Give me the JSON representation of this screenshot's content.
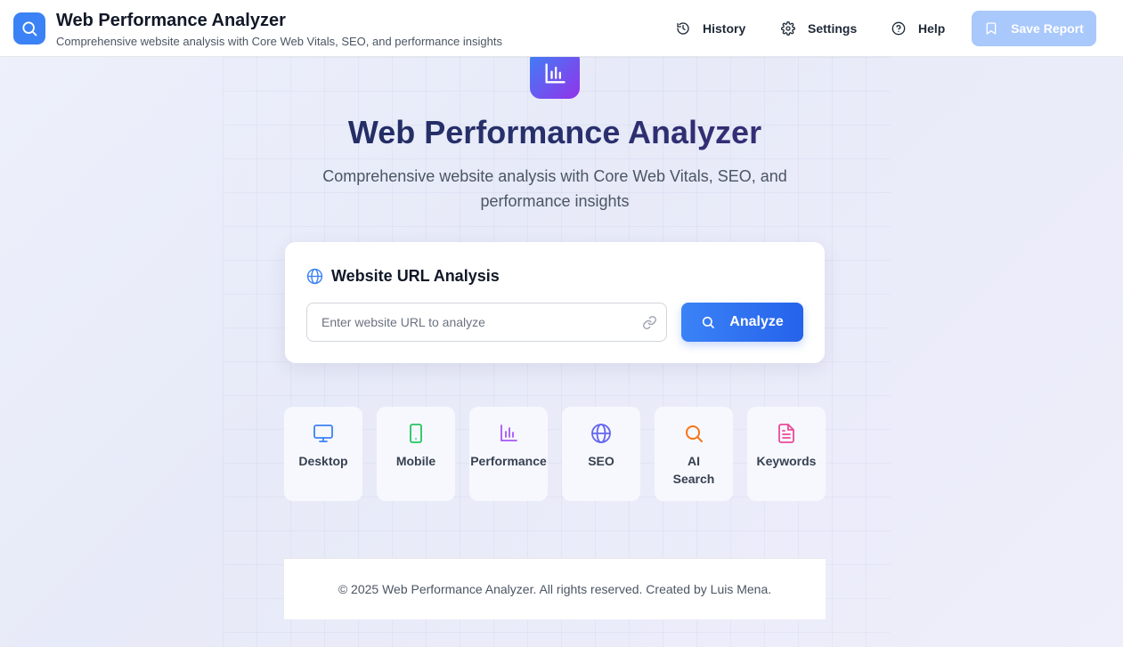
{
  "header": {
    "title": "Web Performance Analyzer",
    "subtitle": "Comprehensive website analysis with Core Web Vitals, SEO, and performance insights",
    "nav": [
      {
        "label": "History",
        "icon": "history-icon"
      },
      {
        "label": "Settings",
        "icon": "gear-icon"
      },
      {
        "label": "Help",
        "icon": "help-icon"
      }
    ],
    "save_label": "Save Report"
  },
  "hero": {
    "title": "Web Performance Analyzer",
    "subtitle": "Comprehensive website analysis with Core Web Vitals, SEO, and performance insights"
  },
  "url_card": {
    "heading": "Website URL Analysis",
    "input_placeholder": "Enter website URL to analyze",
    "input_value": "",
    "analyze_label": "Analyze"
  },
  "features": [
    {
      "label": "Desktop",
      "icon": "monitor-icon",
      "color": "#3b82f6"
    },
    {
      "label": "Mobile",
      "icon": "smartphone-icon",
      "color": "#22c55e"
    },
    {
      "label": "Performance",
      "icon": "bar-chart-icon",
      "color": "#a855f7"
    },
    {
      "label": "SEO",
      "icon": "globe-icon",
      "color": "#6366f1"
    },
    {
      "label": "AI Search",
      "icon": "search-icon",
      "color": "#f97316"
    },
    {
      "label": "Keywords",
      "icon": "file-text-icon",
      "color": "#ec4899"
    }
  ],
  "footer": {
    "text": "© 2025 Web Performance Analyzer. All rights reserved. Created by Luis Mena."
  },
  "colors": {
    "accent": "#3b82f6",
    "save_disabled": "#a9c8fb"
  }
}
